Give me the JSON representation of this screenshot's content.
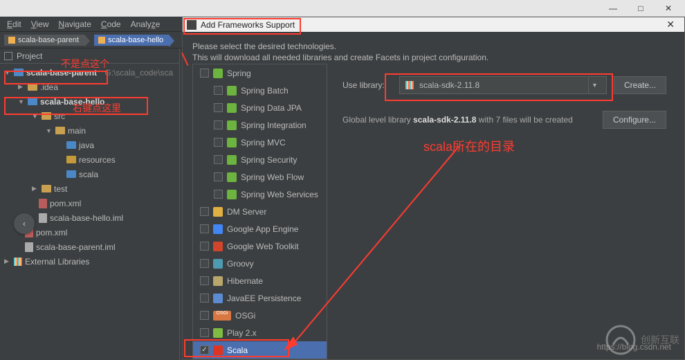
{
  "titlebar": {
    "min": "—",
    "max": "□",
    "close": "✕"
  },
  "menu": {
    "edit": "Edit",
    "view": "View",
    "navigate": "Navigate",
    "code": "Code",
    "analyze": "Analyze"
  },
  "breadcrumb": {
    "a": "scala-base-parent",
    "b": "scala-base-hello"
  },
  "project": {
    "label": "Project",
    "root": "scala-base-parent",
    "root_path": "G:\\scala_code\\sca",
    "idea": ".idea",
    "hello": "scala-base-hello",
    "src": "src",
    "mainf": "main",
    "java": "java",
    "resources": "resources",
    "scala": "scala",
    "test": "test",
    "pom": "pom.xml",
    "iml_hello": "scala-base-hello.iml",
    "pom2": "pom.xml",
    "iml_parent": "scala-base-parent.iml",
    "ext": "External Libraries"
  },
  "annotations": {
    "a1": "不是点这个",
    "a2": "右键点这里",
    "a3": "scala所在的目录"
  },
  "dialog": {
    "title": "Add Frameworks Support",
    "line1": "Please select the desired technologies.",
    "line2": "This will download all needed libraries and create Facets in project configuration.",
    "use_library": "Use library:",
    "sdk": "scala-sdk-2.11.8",
    "create": "Create...",
    "status_a": "Global level library ",
    "status_b": "scala-sdk-2.11.8",
    "status_c": " with 7 files will be created",
    "configure": "Configure..."
  },
  "frameworks": {
    "items": [
      {
        "name": "Spring",
        "indent": 10,
        "color": "#6db33f"
      },
      {
        "name": "Spring Batch",
        "indent": 30,
        "color": "#6db33f"
      },
      {
        "name": "Spring Data JPA",
        "indent": 30,
        "color": "#6db33f"
      },
      {
        "name": "Spring Integration",
        "indent": 30,
        "color": "#6db33f"
      },
      {
        "name": "Spring MVC",
        "indent": 30,
        "color": "#6db33f"
      },
      {
        "name": "Spring Security",
        "indent": 30,
        "color": "#6db33f"
      },
      {
        "name": "Spring Web Flow",
        "indent": 30,
        "color": "#6db33f"
      },
      {
        "name": "Spring Web Services",
        "indent": 30,
        "color": "#6db33f"
      },
      {
        "name": "DM Server",
        "indent": 10,
        "color": "#e0b040"
      },
      {
        "name": "Google App Engine",
        "indent": 10,
        "color": "#4285f4"
      },
      {
        "name": "Google Web Toolkit",
        "indent": 10,
        "color": "#d2452d"
      },
      {
        "name": "Groovy",
        "indent": 10,
        "color": "#4e9bb0"
      },
      {
        "name": "Hibernate",
        "indent": 10,
        "color": "#b9a66c"
      },
      {
        "name": "JavaEE Persistence",
        "indent": 10,
        "color": "#5b8bd0"
      },
      {
        "name": "OSGi",
        "indent": 10,
        "color": "#d97742",
        "osgi": true
      },
      {
        "name": "Play 2.x",
        "indent": 10,
        "color": "#7fba43"
      },
      {
        "name": "Scala",
        "indent": 10,
        "color": "#de3423",
        "sel": true,
        "checked": true
      }
    ]
  },
  "watermark": {
    "url": "https://blog.csdn.net",
    "brand": "创新互联"
  }
}
